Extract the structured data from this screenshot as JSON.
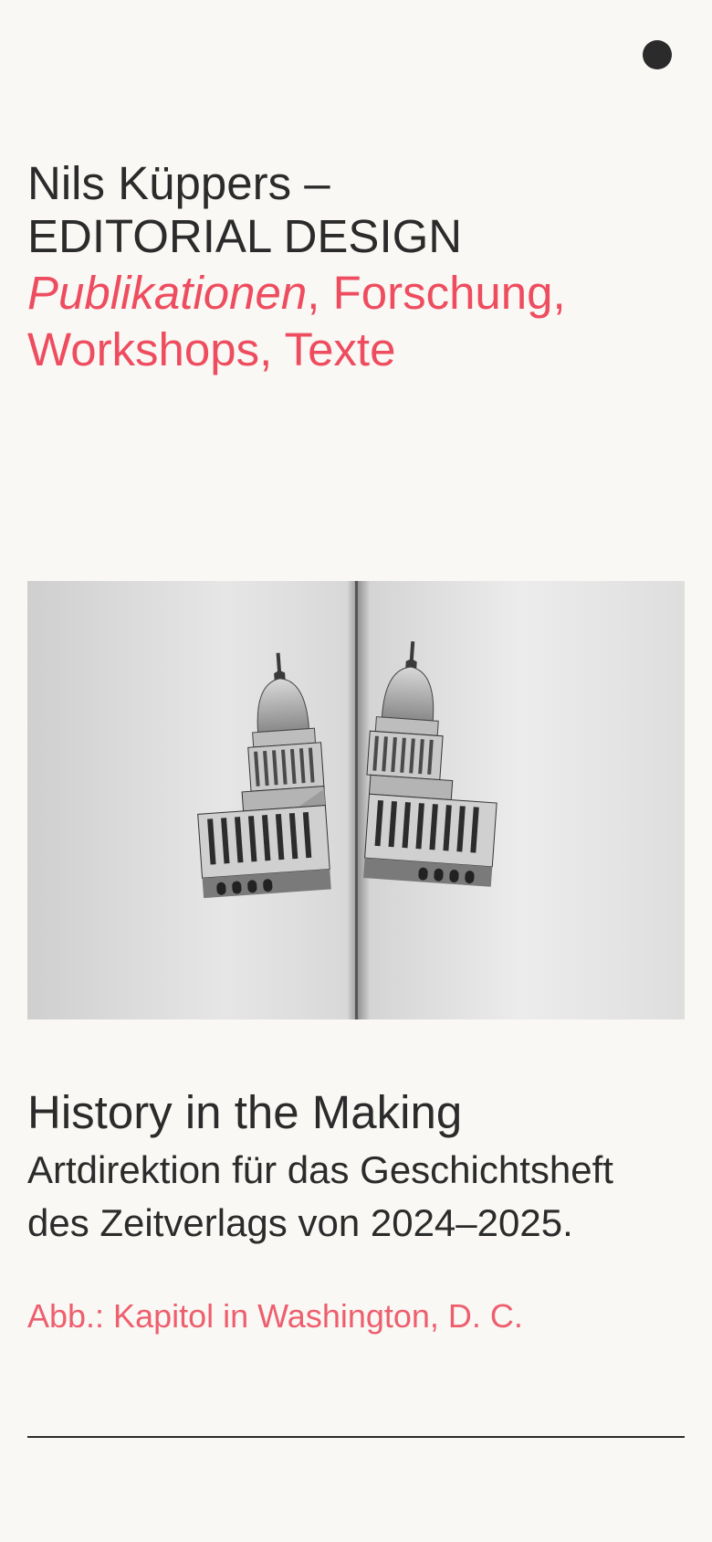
{
  "header": {
    "name_line": "Nils Küppers –",
    "role_line": "EDITORIAL DESIGN",
    "accent_italic": "Publikationen",
    "accent_rest_1": ", Forschung,",
    "accent_line_2": "Workshops, Texte"
  },
  "menu": {
    "icon": "menu-dot-icon"
  },
  "hero": {
    "image_description_icon": "open-magazine-capitol-image"
  },
  "project": {
    "title": "History in the Making",
    "description_line_1": "Artdirektion für das Geschichtsheft",
    "description_line_2": "des Zeitverlags von 2024–2025.",
    "caption": "Abb.: Kapitol in Washington, D. C."
  },
  "colors": {
    "background": "#f9f8f5",
    "text": "#2b2b2b",
    "accent": "#ee4d5f"
  }
}
